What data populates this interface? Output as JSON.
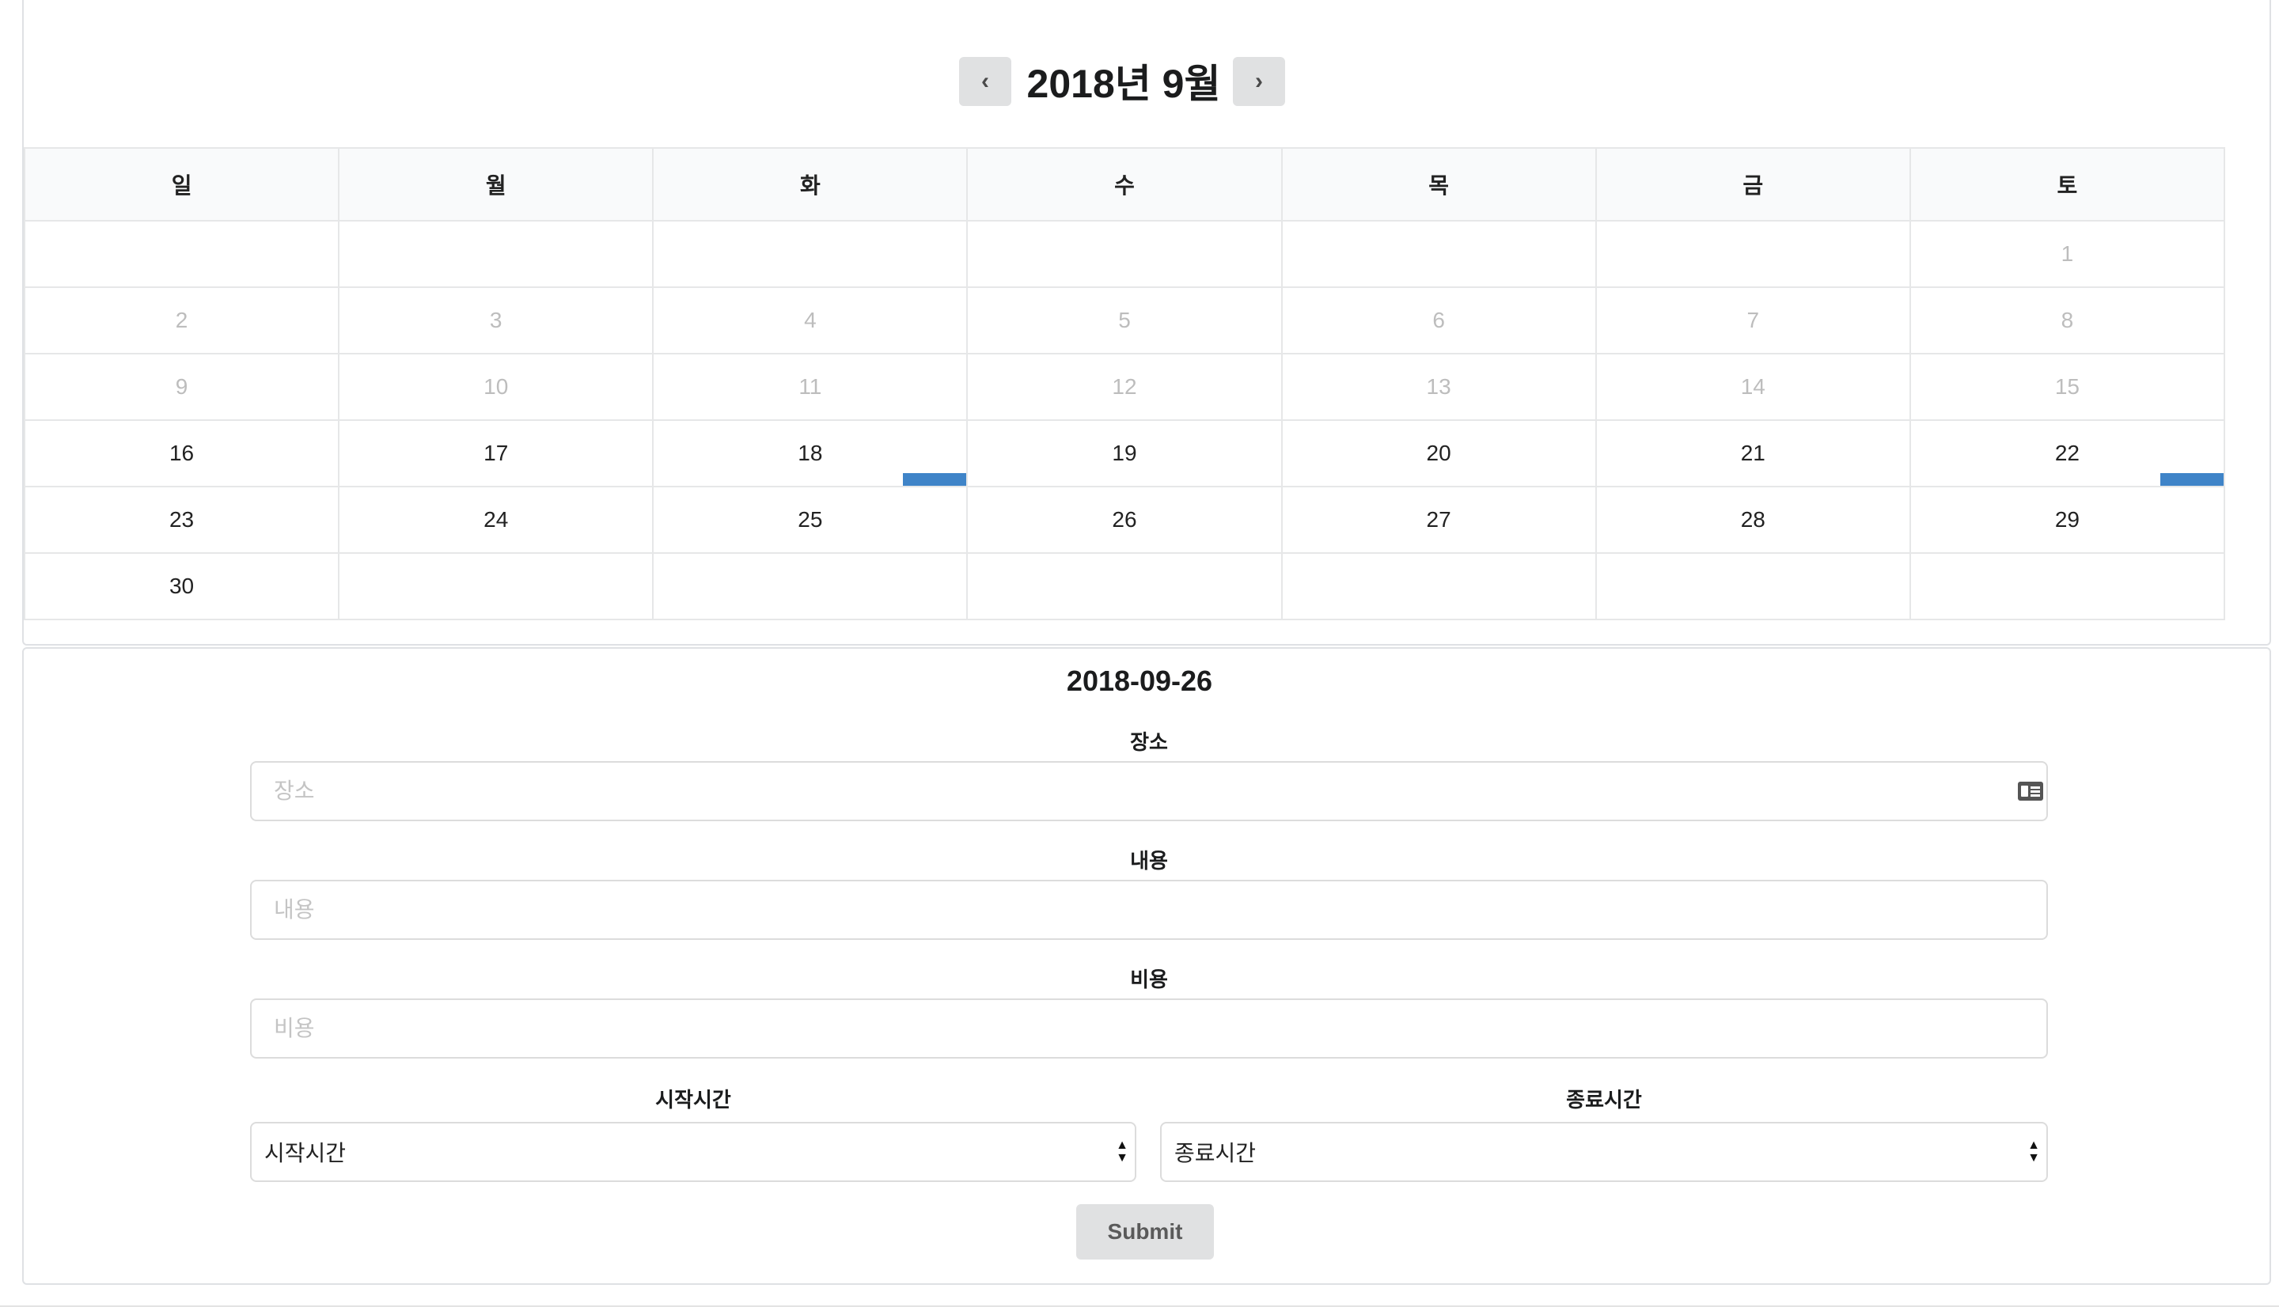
{
  "calendar": {
    "title": "2018년 9월",
    "prev_label": "‹",
    "next_label": "›",
    "weekdays": [
      "일",
      "월",
      "화",
      "수",
      "목",
      "금",
      "토"
    ],
    "weeks": [
      [
        "",
        "",
        "",
        "",
        "",
        "",
        "1"
      ],
      [
        "2",
        "3",
        "4",
        "5",
        "6",
        "7",
        "8"
      ],
      [
        "9",
        "10",
        "11",
        "12",
        "13",
        "14",
        "15"
      ],
      [
        "16",
        "17",
        "18",
        "19",
        "20",
        "21",
        "22"
      ],
      [
        "23",
        "24",
        "25",
        "26",
        "27",
        "28",
        "29"
      ],
      [
        "30",
        "",
        "",
        "",
        "",
        "",
        ""
      ]
    ],
    "past_weeks_count": 3,
    "event_days": [
      "18",
      "22"
    ],
    "event_color": "#3f84c8"
  },
  "form": {
    "selected_date": "2018-09-26",
    "place_label": "장소",
    "place_placeholder": "장소",
    "content_label": "내용",
    "content_placeholder": "내용",
    "cost_label": "비용",
    "cost_placeholder": "비용",
    "start_label": "시작시간",
    "start_value": "시작시간",
    "end_label": "종료시간",
    "end_value": "종료시간",
    "submit_label": "Submit"
  }
}
